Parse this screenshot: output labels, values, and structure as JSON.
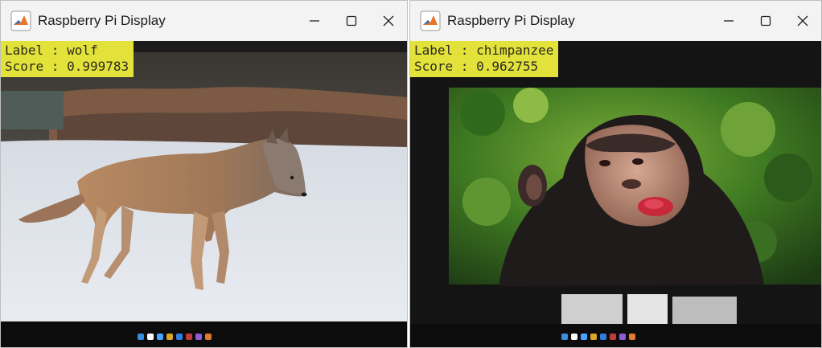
{
  "windows": [
    {
      "title": "Raspberry Pi Display",
      "overlay": {
        "label_line": "Label : wolf",
        "score_line": "Score : 0.999783"
      },
      "photo": {
        "subject": "wolf-walking-on-snow"
      },
      "controls": {
        "minimize": "minimize-icon",
        "maximize": "maximize-icon",
        "close": "close-icon"
      }
    },
    {
      "title": "Raspberry Pi Display",
      "overlay": {
        "label_line": "Label : chimpanzee",
        "score_line": "Score : 0.962755"
      },
      "photo": {
        "subject": "chimpanzee-in-foliage"
      },
      "controls": {
        "minimize": "minimize-icon",
        "maximize": "maximize-icon",
        "close": "close-icon"
      }
    }
  ],
  "colors": {
    "overlay_bg": "#e3e23a",
    "titlebar_bg": "#f3f3f3",
    "screen_bg": "#1a1a1a"
  }
}
